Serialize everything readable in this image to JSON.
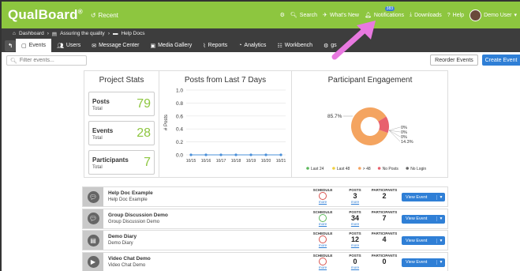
{
  "app": {
    "logo": "QualBoard",
    "logo_mark": "®",
    "recent": "Recent"
  },
  "topnav": {
    "search": "Search",
    "whats_new": "What's New",
    "notifications": "Notifications",
    "notifications_badge": "383",
    "downloads": "Downloads",
    "help": "Help",
    "user": "Demo User"
  },
  "breadcrumb": [
    "Dashboard",
    "Assuring the quality",
    "Help Docs"
  ],
  "tabs": [
    {
      "label": "Events"
    },
    {
      "label": "Users"
    },
    {
      "label": "Message Center"
    },
    {
      "label": "Media Gallery"
    },
    {
      "label": "Reports"
    },
    {
      "label": "Analytics"
    },
    {
      "label": "Workbench"
    },
    {
      "label": "gs"
    }
  ],
  "filter": {
    "placeholder": "Filter events..."
  },
  "actions": {
    "reorder": "Reorder Events",
    "create": "Create Event"
  },
  "project_stats": {
    "title": "Project Stats",
    "items": [
      {
        "name": "Posts",
        "sub": "Total",
        "value": "79"
      },
      {
        "name": "Events",
        "sub": "Total",
        "value": "28"
      },
      {
        "name": "Participants",
        "sub": "Total",
        "value": "7"
      }
    ]
  },
  "posts_chart": {
    "title": "Posts from Last 7 Days",
    "ylabel": "# Posts"
  },
  "engagement": {
    "title": "Participant Engagement",
    "label_big": "85.7%",
    "labels_small": [
      "0%",
      "0%",
      "0%",
      "14.3%"
    ],
    "legend": [
      "Last 24",
      "Last 48",
      "> 48",
      "No Posts",
      "No Login"
    ]
  },
  "chart_data": [
    {
      "type": "line",
      "title": "Posts from Last 7 Days",
      "xlabel": "",
      "ylabel": "# Posts",
      "x": [
        "10/15",
        "10/16",
        "10/17",
        "10/18",
        "10/19",
        "10/20",
        "10/21"
      ],
      "values": [
        0,
        0,
        0,
        0,
        0,
        0,
        0
      ],
      "ylim": [
        0,
        1.0
      ],
      "yticks": [
        "0.0",
        "0.2",
        "0.4",
        "0.6",
        "0.8",
        "1.0"
      ],
      "color": "#4a90d9",
      "grid": true
    },
    {
      "type": "pie",
      "title": "Participant Engagement",
      "categories": [
        "Last 24",
        "Last 48",
        "> 48",
        "No Posts",
        "No Login"
      ],
      "values": [
        0,
        0,
        85.7,
        14.3,
        0
      ],
      "colors": [
        "#5cb85c",
        "#f0d040",
        "#f4a460",
        "#e8616e",
        "#666666"
      ],
      "donut": true,
      "legend": "bottom"
    }
  ],
  "events": [
    {
      "title": "Help Doc Example",
      "sub": "Help Doc Example",
      "icon": "chat-icon",
      "sched_status": "red",
      "posts": "3",
      "participants": "2"
    },
    {
      "title": "Group Discussion Demo",
      "sub": "Group Discussion Demo",
      "icon": "chat-icon",
      "sched_status": "green",
      "posts": "34",
      "participants": "7"
    },
    {
      "title": "Demo Diary",
      "sub": "Demo Diary",
      "icon": "diary-icon",
      "sched_status": "red",
      "posts": "12",
      "participants": "4"
    },
    {
      "title": "Video Chat Demo",
      "sub": "Video Chat Demo",
      "icon": "video-icon",
      "sched_status": "red",
      "posts": "0",
      "participants": "0"
    }
  ],
  "event_cols": {
    "schedule": "SCHEDULE",
    "posts": "POSTS",
    "participants": "PARTICIPANTS",
    "more": "more",
    "view": "View Event"
  },
  "colors": {
    "brand_green": "#8dc63f",
    "nav_dark": "#3d3d3d",
    "primary_blue": "#2f7fd6",
    "annotation_arrow": "#e879e0"
  }
}
